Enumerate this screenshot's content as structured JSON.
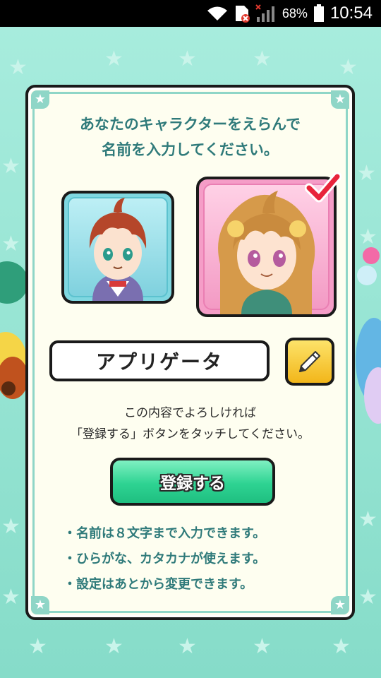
{
  "status_bar": {
    "battery_percent": "68%",
    "time": "10:54",
    "icons": [
      "wifi-icon",
      "sim-error-icon",
      "signal-no-data-icon",
      "battery-icon"
    ]
  },
  "dialog": {
    "title_lines": [
      "あなたのキャラクターをえらんで",
      "名前を入力してください。"
    ],
    "characters": [
      {
        "name": "boy-avatar",
        "selected": false
      },
      {
        "name": "girl-avatar",
        "selected": true
      }
    ],
    "name_value": "アプリゲータ",
    "confirm_lines": [
      "この内容でよろしければ",
      "「登録する」ボタンをタッチしてください。"
    ],
    "register_label": "登録する",
    "notes": [
      "・名前は８文字まで入力できます。",
      "・ひらがな、カタカナが使えます。",
      "・設定はあとから変更できます。"
    ]
  },
  "colors": {
    "accent_teal": "#2f7a7a",
    "button_green": "#2ed392",
    "edit_yellow": "#f2b61a",
    "check_red": "#e8243b",
    "background": "#a7ecdd"
  }
}
